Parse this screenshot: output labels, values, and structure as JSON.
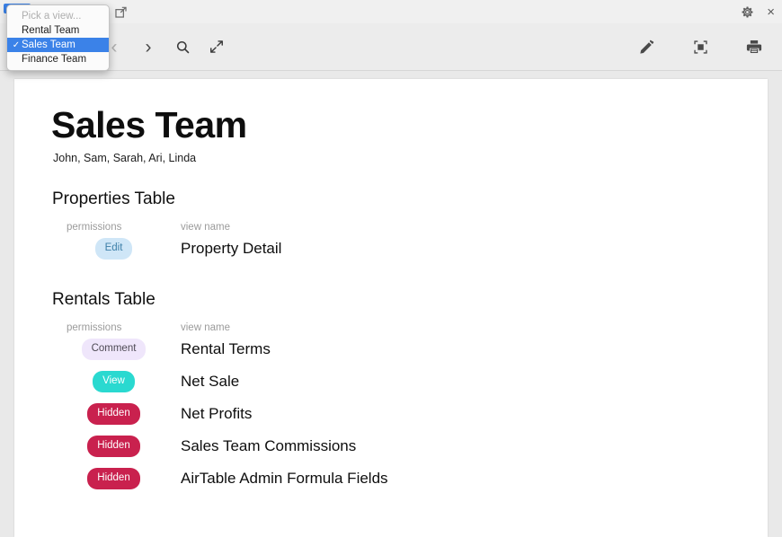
{
  "window": {
    "document_title": "Sales Team",
    "share_icon": "share-export-icon",
    "dropdown_caret": "▾",
    "gear_icon": "gear-icon",
    "close_icon": "×"
  },
  "toolbar": {
    "back_icon": "chevron-left-icon",
    "back_label": "‹",
    "forward_icon": "chevron-right-icon",
    "forward_label": "›",
    "search_icon": "search-icon",
    "expand_icon": "expand-arrows-icon",
    "markup_icon": "pencil-icon",
    "crop_icon": "selection-frame-icon",
    "print_icon": "printer-icon"
  },
  "view_menu": {
    "placeholder": "Pick a view...",
    "checkmark": "✓",
    "items": [
      {
        "label": "Rental Team",
        "selected": false
      },
      {
        "label": "Sales Team",
        "selected": true
      },
      {
        "label": "Finance Team",
        "selected": false
      }
    ]
  },
  "document": {
    "title": "Sales Team",
    "subtitle": "John, Sam, Sarah, Ari, Linda",
    "columns": {
      "permissions": "permissions",
      "view_name": "view name"
    },
    "sections": [
      {
        "heading": "Properties Table",
        "rows": [
          {
            "permission": "Edit",
            "view_name": "Property Detail",
            "badge_bg": "#cfe6f7",
            "badge_fg": "#3d7fa8"
          }
        ]
      },
      {
        "heading": "Rentals Table",
        "rows": [
          {
            "permission": "Comment",
            "view_name": "Rental Terms",
            "badge_bg": "#efe6fb",
            "badge_fg": "#4e4a55"
          },
          {
            "permission": "View",
            "view_name": "Net Sale",
            "badge_bg": "#2ad9d0",
            "badge_fg": "#ffffff"
          },
          {
            "permission": "Hidden",
            "view_name": "Net Profits",
            "badge_bg": "#c9214e",
            "badge_fg": "#ffffff"
          },
          {
            "permission": "Hidden",
            "view_name": "Sales Team Commissions",
            "badge_bg": "#c9214e",
            "badge_fg": "#ffffff"
          },
          {
            "permission": "Hidden",
            "view_name": "AirTable Admin Formula Fields",
            "badge_bg": "#c9214e",
            "badge_fg": "#ffffff"
          }
        ]
      }
    ]
  },
  "colors": {
    "accent_blue": "#3b82e8",
    "page_bg": "#ffffff",
    "window_bg": "#e9e9e9"
  }
}
